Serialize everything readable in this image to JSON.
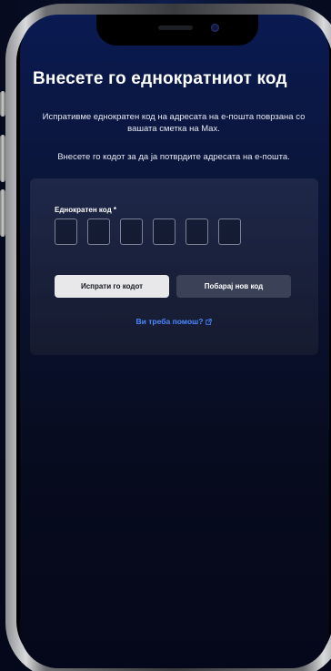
{
  "page": {
    "title": "Внесете го еднократниот код",
    "subtitle_line1": "Испративме еднократен код на адресата на е-пошта поврзана со вашата сметка на Max.",
    "subtitle_line2": "Внесете го кодот за да ја потврдите адресата на е-пошта."
  },
  "form": {
    "code_label": "Еднократен код *",
    "code_digits": [
      "",
      "",
      "",
      "",
      "",
      ""
    ],
    "send_button_label": "Испрати го кодот",
    "resend_button_label": "Побарај нов код",
    "help_link_label": "Ви треба помош?",
    "help_link_icon": "external-link-icon"
  },
  "colors": {
    "accent_link": "#4b87ff",
    "primary_button_bg": "#e8e8ea",
    "secondary_button_bg": "#3b4258"
  }
}
